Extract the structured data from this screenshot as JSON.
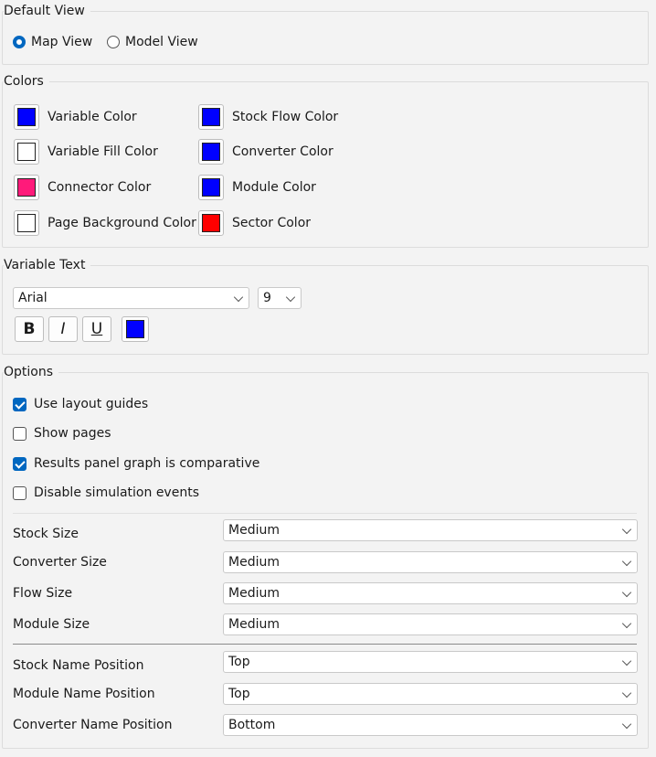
{
  "default_view": {
    "title": "Default View",
    "options": [
      "Map View",
      "Model View"
    ],
    "selected": "Map View"
  },
  "colors": {
    "title": "Colors",
    "items": [
      {
        "label": "Variable Color",
        "color": "#0000ff"
      },
      {
        "label": "Variable Fill Color",
        "color": "#ffffff"
      },
      {
        "label": "Connector Color",
        "color": "#ff1a7a"
      },
      {
        "label": "Page Background Color",
        "color": "#ffffff"
      },
      {
        "label": "Stock Flow Color",
        "color": "#0000ff"
      },
      {
        "label": "Converter Color",
        "color": "#0000ff"
      },
      {
        "label": "Module Color",
        "color": "#0000ff"
      },
      {
        "label": "Sector Color",
        "color": "#ff0000"
      }
    ]
  },
  "variable_text": {
    "title": "Variable Text",
    "font": "Arial",
    "size": "9",
    "bold_label": "B",
    "italic_label": "I",
    "underline_label": "U",
    "text_color": "#0000ff"
  },
  "options": {
    "title": "Options",
    "checks": [
      {
        "label": "Use layout guides",
        "checked": true
      },
      {
        "label": "Show pages",
        "checked": false
      },
      {
        "label": "Results panel graph is comparative",
        "checked": true
      },
      {
        "label": "Disable simulation events",
        "checked": false
      }
    ],
    "sizes": [
      {
        "label": "Stock Size",
        "value": "Medium"
      },
      {
        "label": "Converter Size",
        "value": "Medium"
      },
      {
        "label": "Flow Size",
        "value": "Medium"
      },
      {
        "label": "Module Size",
        "value": "Medium"
      }
    ],
    "positions": [
      {
        "label": "Stock Name Position",
        "value": "Top"
      },
      {
        "label": "Module Name Position",
        "value": "Top"
      },
      {
        "label": "Converter Name Position",
        "value": "Bottom"
      }
    ]
  }
}
